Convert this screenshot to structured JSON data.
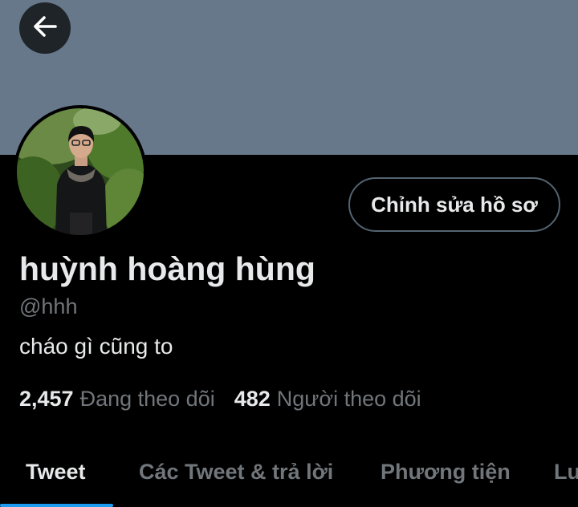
{
  "header": {
    "back_icon": "arrow-left-icon",
    "banner_color": "#66788a"
  },
  "profile": {
    "edit_button_label": "Chỉnh sửa hồ sơ",
    "display_name": "huỳnh hoàng hùng",
    "handle": "@hhh",
    "bio": "cháo gì cũng to",
    "following_count": "2,457",
    "following_label": "Đang theo dõi",
    "followers_count": "482",
    "followers_label": "Người theo dõi"
  },
  "tabs": [
    {
      "label": "Tweet",
      "active": true
    },
    {
      "label": "Các Tweet & trả lời",
      "active": false
    },
    {
      "label": "Phương tiện",
      "active": false
    },
    {
      "label": "Lư",
      "active": false
    }
  ],
  "colors": {
    "background": "#000000",
    "primary_text": "#e7e9ea",
    "secondary_text": "#71767b",
    "accent": "#1d9bf0",
    "border": "#536471"
  }
}
